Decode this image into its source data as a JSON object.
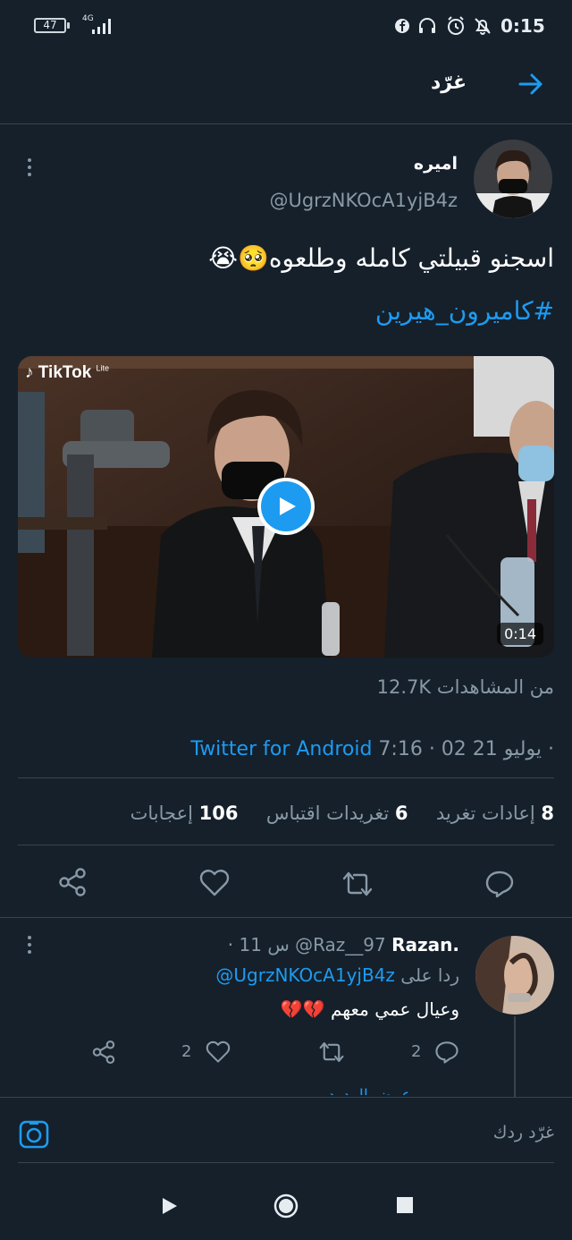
{
  "status_bar": {
    "battery": "47",
    "network": "4G",
    "time": "0:15"
  },
  "header": {
    "title": "غرّد"
  },
  "tweet": {
    "display_name": "اميره",
    "handle": "@UgrzNKOcA1yjB4z",
    "text": "اسجنو قبيلتي كامله وطلعوه🥺😭",
    "hashtag": "#كاميرون_هيرين",
    "video": {
      "watermark": "TikTok",
      "watermark_sup": "Lite",
      "duration": "0:14"
    },
    "views": "12.7K من المشاهدات",
    "time": "7:16 · 02 يوليو 21 ·",
    "source": "Twitter for Android",
    "stats": {
      "retweets_count": "8",
      "retweets_label": "إعادات تغريد",
      "quotes_count": "6",
      "quotes_label": "تغريدات اقتباس",
      "likes_count": "106",
      "likes_label": "إعجابات"
    }
  },
  "reply": {
    "name": "Razan.",
    "handle": "@Raz__97",
    "time": "· 11 س",
    "replying_to_label": "ردا على",
    "replying_to_handle": "@UgrzNKOcA1yjB4z",
    "text": "وعيال عمي معهم 💔💔",
    "reply_count": "2",
    "like_count": "2",
    "partial_text": "عرض الردود"
  },
  "composer": {
    "placeholder": "غرّد ردك"
  }
}
